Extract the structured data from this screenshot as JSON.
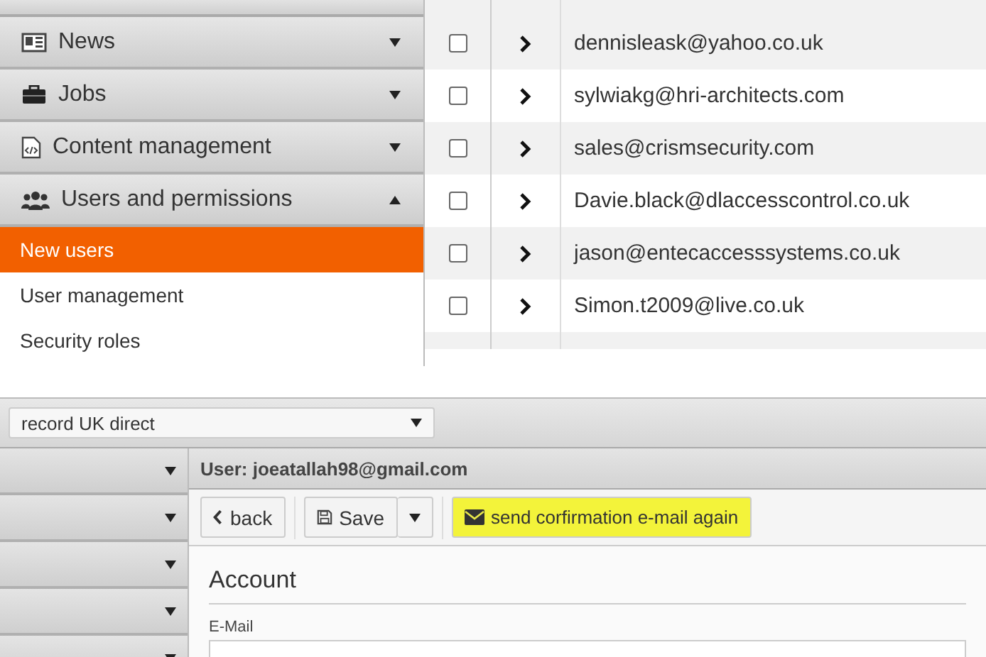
{
  "top_panel": {
    "sidebar": {
      "items": [
        {
          "kind": "group",
          "label": "News",
          "expanded": false
        },
        {
          "kind": "group",
          "label": "Jobs",
          "expanded": false
        },
        {
          "kind": "group",
          "label": "Content management",
          "expanded": false
        },
        {
          "kind": "group",
          "label": "Users and permissions",
          "expanded": true
        },
        {
          "kind": "link",
          "label": "New users",
          "selected": true
        },
        {
          "kind": "link",
          "label": "User management",
          "selected": false
        },
        {
          "kind": "link",
          "label": "Security roles",
          "selected": false
        }
      ]
    },
    "table": {
      "rows": [
        {
          "email": "dennisleask@yahoo.co.uk",
          "checked": false
        },
        {
          "email": "sylwiakg@hri-architects.com",
          "checked": false
        },
        {
          "email": "sales@crismsecurity.com",
          "checked": false
        },
        {
          "email": "Davie.black@dlaccesscontrol.co.uk",
          "checked": false
        },
        {
          "email": "jason@entecaccesssystems.co.uk",
          "checked": false
        },
        {
          "email": "Simon.t2009@live.co.uk",
          "checked": false
        }
      ]
    }
  },
  "bottom_panel": {
    "site_select": {
      "value": "record UK direct"
    },
    "header": "User: joeatallah98@gmail.com",
    "toolbar": {
      "back": "back",
      "save": "Save",
      "send": {
        "label": "send corfirmation e-mail again",
        "highlighted": true
      }
    },
    "section_title": "Account",
    "email_label": "E-Mail"
  }
}
